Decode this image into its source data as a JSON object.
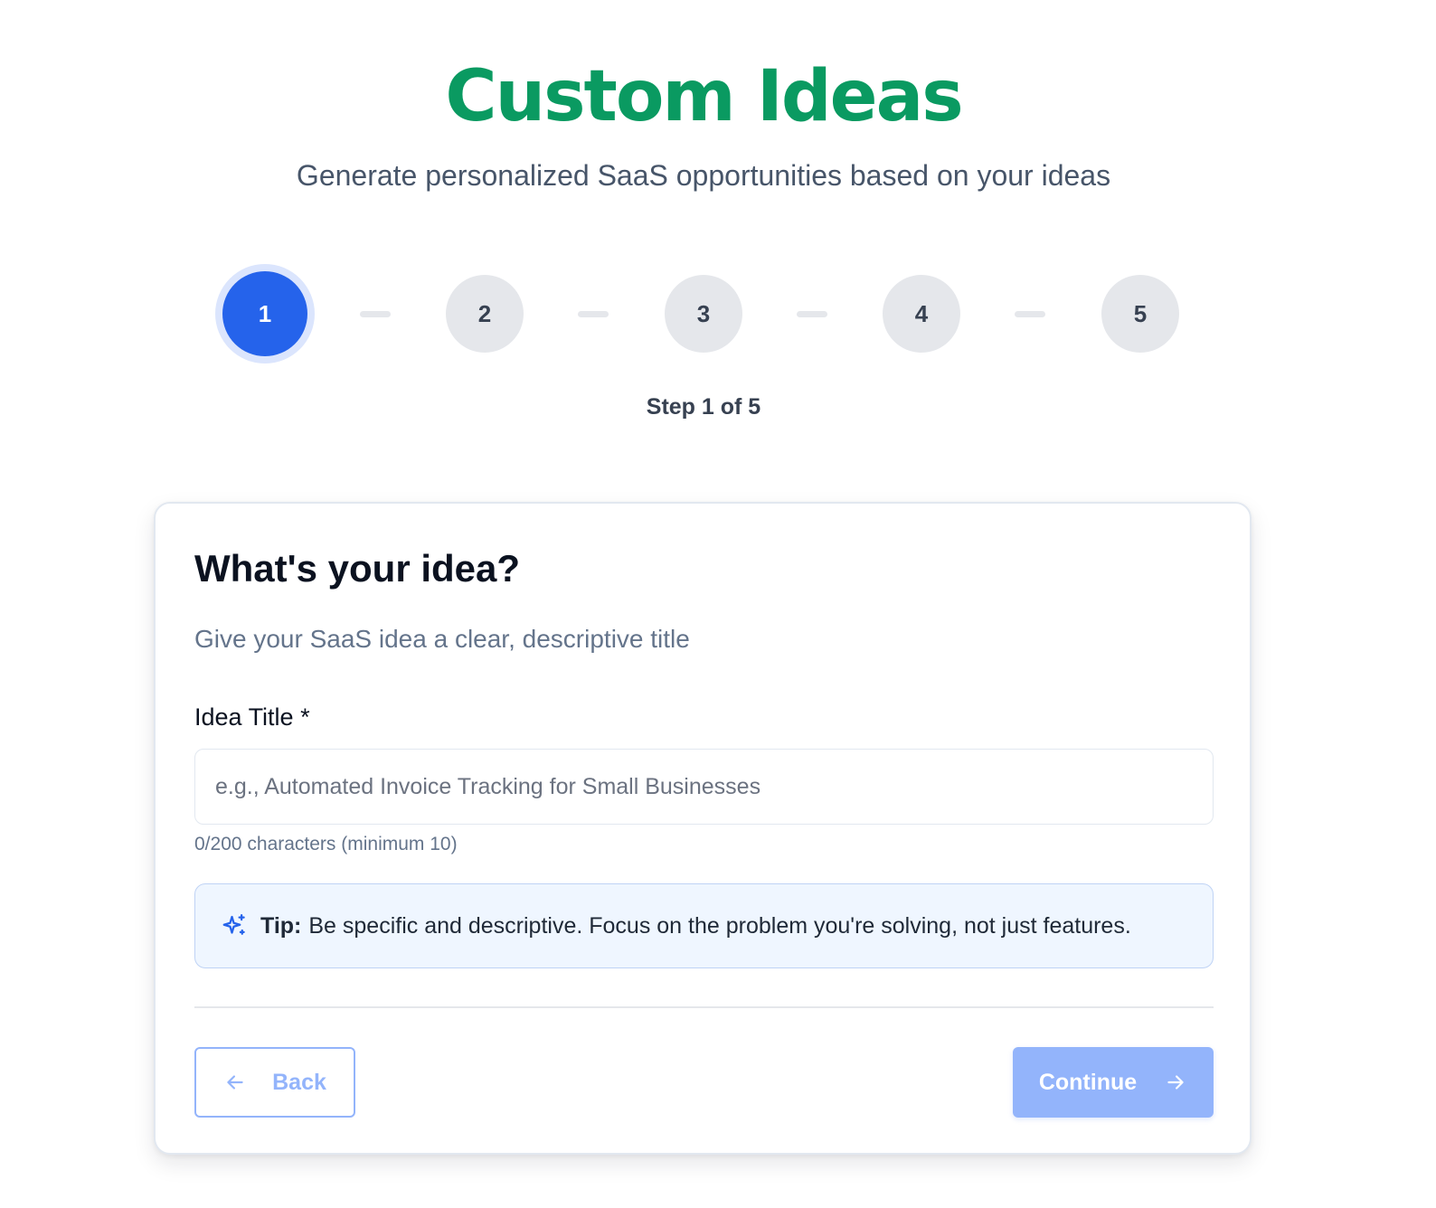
{
  "header": {
    "title": "Custom Ideas",
    "subtitle": "Generate personalized SaaS opportunities based on your ideas"
  },
  "stepper": {
    "steps": [
      "1",
      "2",
      "3",
      "4",
      "5"
    ],
    "current": 1,
    "label": "Step 1 of 5"
  },
  "card": {
    "heading": "What's your idea?",
    "description": "Give your SaaS idea a clear, descriptive title",
    "field": {
      "label": "Idea Title",
      "required_mark": "*",
      "value": "",
      "placeholder": "e.g., Automated Invoice Tracking for Small Businesses",
      "char_count": "0/200 characters (minimum 10)"
    },
    "tip": {
      "icon": "sparkles-icon",
      "label": "Tip:",
      "text": "Be specific and descriptive. Focus on the problem you're solving, not just features."
    }
  },
  "actions": {
    "back_label": "Back",
    "back_icon": "arrow-left-icon",
    "continue_label": "Continue",
    "continue_icon": "arrow-right-icon"
  },
  "colors": {
    "title": "#0a9a61",
    "accent": "#2563eb",
    "accent_disabled": "#93b4fb",
    "step_inactive": "#e5e7eb",
    "tip_background": "#eff6ff"
  }
}
